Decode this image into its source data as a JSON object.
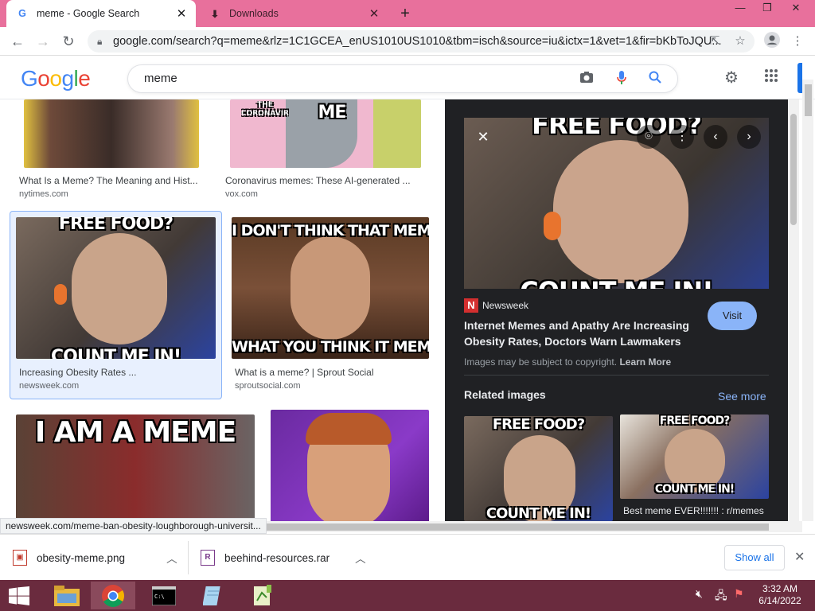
{
  "browser": {
    "tabs": [
      {
        "title": "meme - Google Search",
        "favicon": "G"
      },
      {
        "title": "Downloads",
        "favicon": "download-icon"
      }
    ],
    "new_tab": "+",
    "url": "google.com/search?q=meme&rlz=1C1GCEA_enUS1010US1010&tbm=isch&source=iu&ictx=1&vet=1&fir=bKbToJQU...",
    "window_controls": {
      "minimize": "—",
      "restore": "❐",
      "close": "✕"
    }
  },
  "google": {
    "logo": [
      "G",
      "o",
      "o",
      "g",
      "l",
      "e"
    ],
    "logo_colors": [
      "#4285f4",
      "#ea4335",
      "#fbbc05",
      "#4285f4",
      "#34a853",
      "#ea4335"
    ],
    "query": "meme"
  },
  "results": [
    {
      "caption": "What Is a Meme? The Meaning and Hist...",
      "source": "nytimes.com"
    },
    {
      "caption": "Coronavirus memes: These AI-generated ...",
      "source": "vox.com",
      "text_left": "THE CORONAVIRUS",
      "text_right": "ME"
    },
    {
      "caption": "Increasing Obesity Rates ...",
      "source": "newsweek.com",
      "top_text": "FREE FOOD?",
      "bottom_text": "COUNT ME IN!"
    },
    {
      "caption": "What is a meme? | Sprout Social",
      "source": "sproutsocial.com",
      "top_text": "I DON'T THINK THAT MEMES",
      "bottom_text": "WHAT YOU THINK IT MEMES"
    },
    {
      "caption": "",
      "source": "",
      "top_text": "I AM A MEME"
    },
    {
      "caption": "",
      "source": ""
    }
  ],
  "panel": {
    "top_text": "FREE FOOD?",
    "bottom_text": "COUNT ME IN!",
    "source_logo": "N",
    "source_name": "Newsweek",
    "title": "Internet Memes and Apathy Are Increasing Obesity Rates, Doctors Warn Lawmakers",
    "visit": "Visit",
    "copyright": "Images may be subject to copyright.",
    "learn_more": "Learn More",
    "related_title": "Related images",
    "see_more": "See more",
    "related": [
      {
        "top_text": "FREE FOOD?",
        "bottom_text": "COUNT ME IN!",
        "caption": ""
      },
      {
        "top_text": "FREE FOOD?",
        "bottom_text": "COUNT ME IN!",
        "caption": "Best meme EVER!!!!!!! : r/memes"
      }
    ]
  },
  "status_url": "newsweek.com/meme-ban-obesity-loughborough-universit...",
  "downloads": {
    "items": [
      {
        "name": "obesity-meme.png"
      },
      {
        "name": "beehind-resources.rar"
      }
    ],
    "show_all": "Show all"
  },
  "taskbar": {
    "time": "3:32 AM",
    "date": "6/14/2022"
  }
}
